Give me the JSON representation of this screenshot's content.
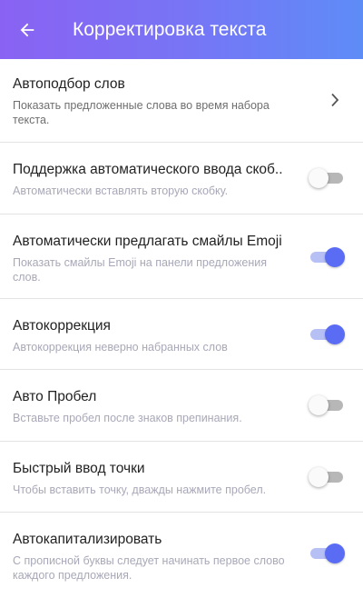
{
  "header": {
    "title": "Корректировка текста",
    "back_icon": "arrow-left-icon"
  },
  "colors": {
    "header_from": "#8a62f3",
    "header_to": "#5e8cf7",
    "toggle_on": "#5a6cf4",
    "toggle_off": "#b7b7b7"
  },
  "settings": [
    {
      "title": "Автоподбор слов",
      "subtitle": "Показать предложенные слова во время набора текста.",
      "control": "chevron"
    },
    {
      "title": "Поддержка автоматического ввода скоб..",
      "subtitle": "Автоматически вставлять вторую скобку.",
      "control": "toggle",
      "on": false
    },
    {
      "title": "Автоматически предлагать смайлы Emoji",
      "subtitle": "Показать смайлы Emoji на панели предложения слов.",
      "control": "toggle",
      "on": true
    },
    {
      "title": "Автокоррекция",
      "subtitle": "Автокоррекция неверно набранных слов",
      "control": "toggle",
      "on": true
    },
    {
      "title": "Авто Пробел",
      "subtitle": "Вставьте пробел после знаков препинания.",
      "control": "toggle",
      "on": false
    },
    {
      "title": "Быстрый ввод точки",
      "subtitle": "Чтобы вставить точку, дважды нажмите пробел.",
      "control": "toggle",
      "on": false
    },
    {
      "title": "Автокапитализировать",
      "subtitle": "С прописной буквы следует начинать первое слово каждого предложения.",
      "control": "toggle",
      "on": true
    }
  ]
}
